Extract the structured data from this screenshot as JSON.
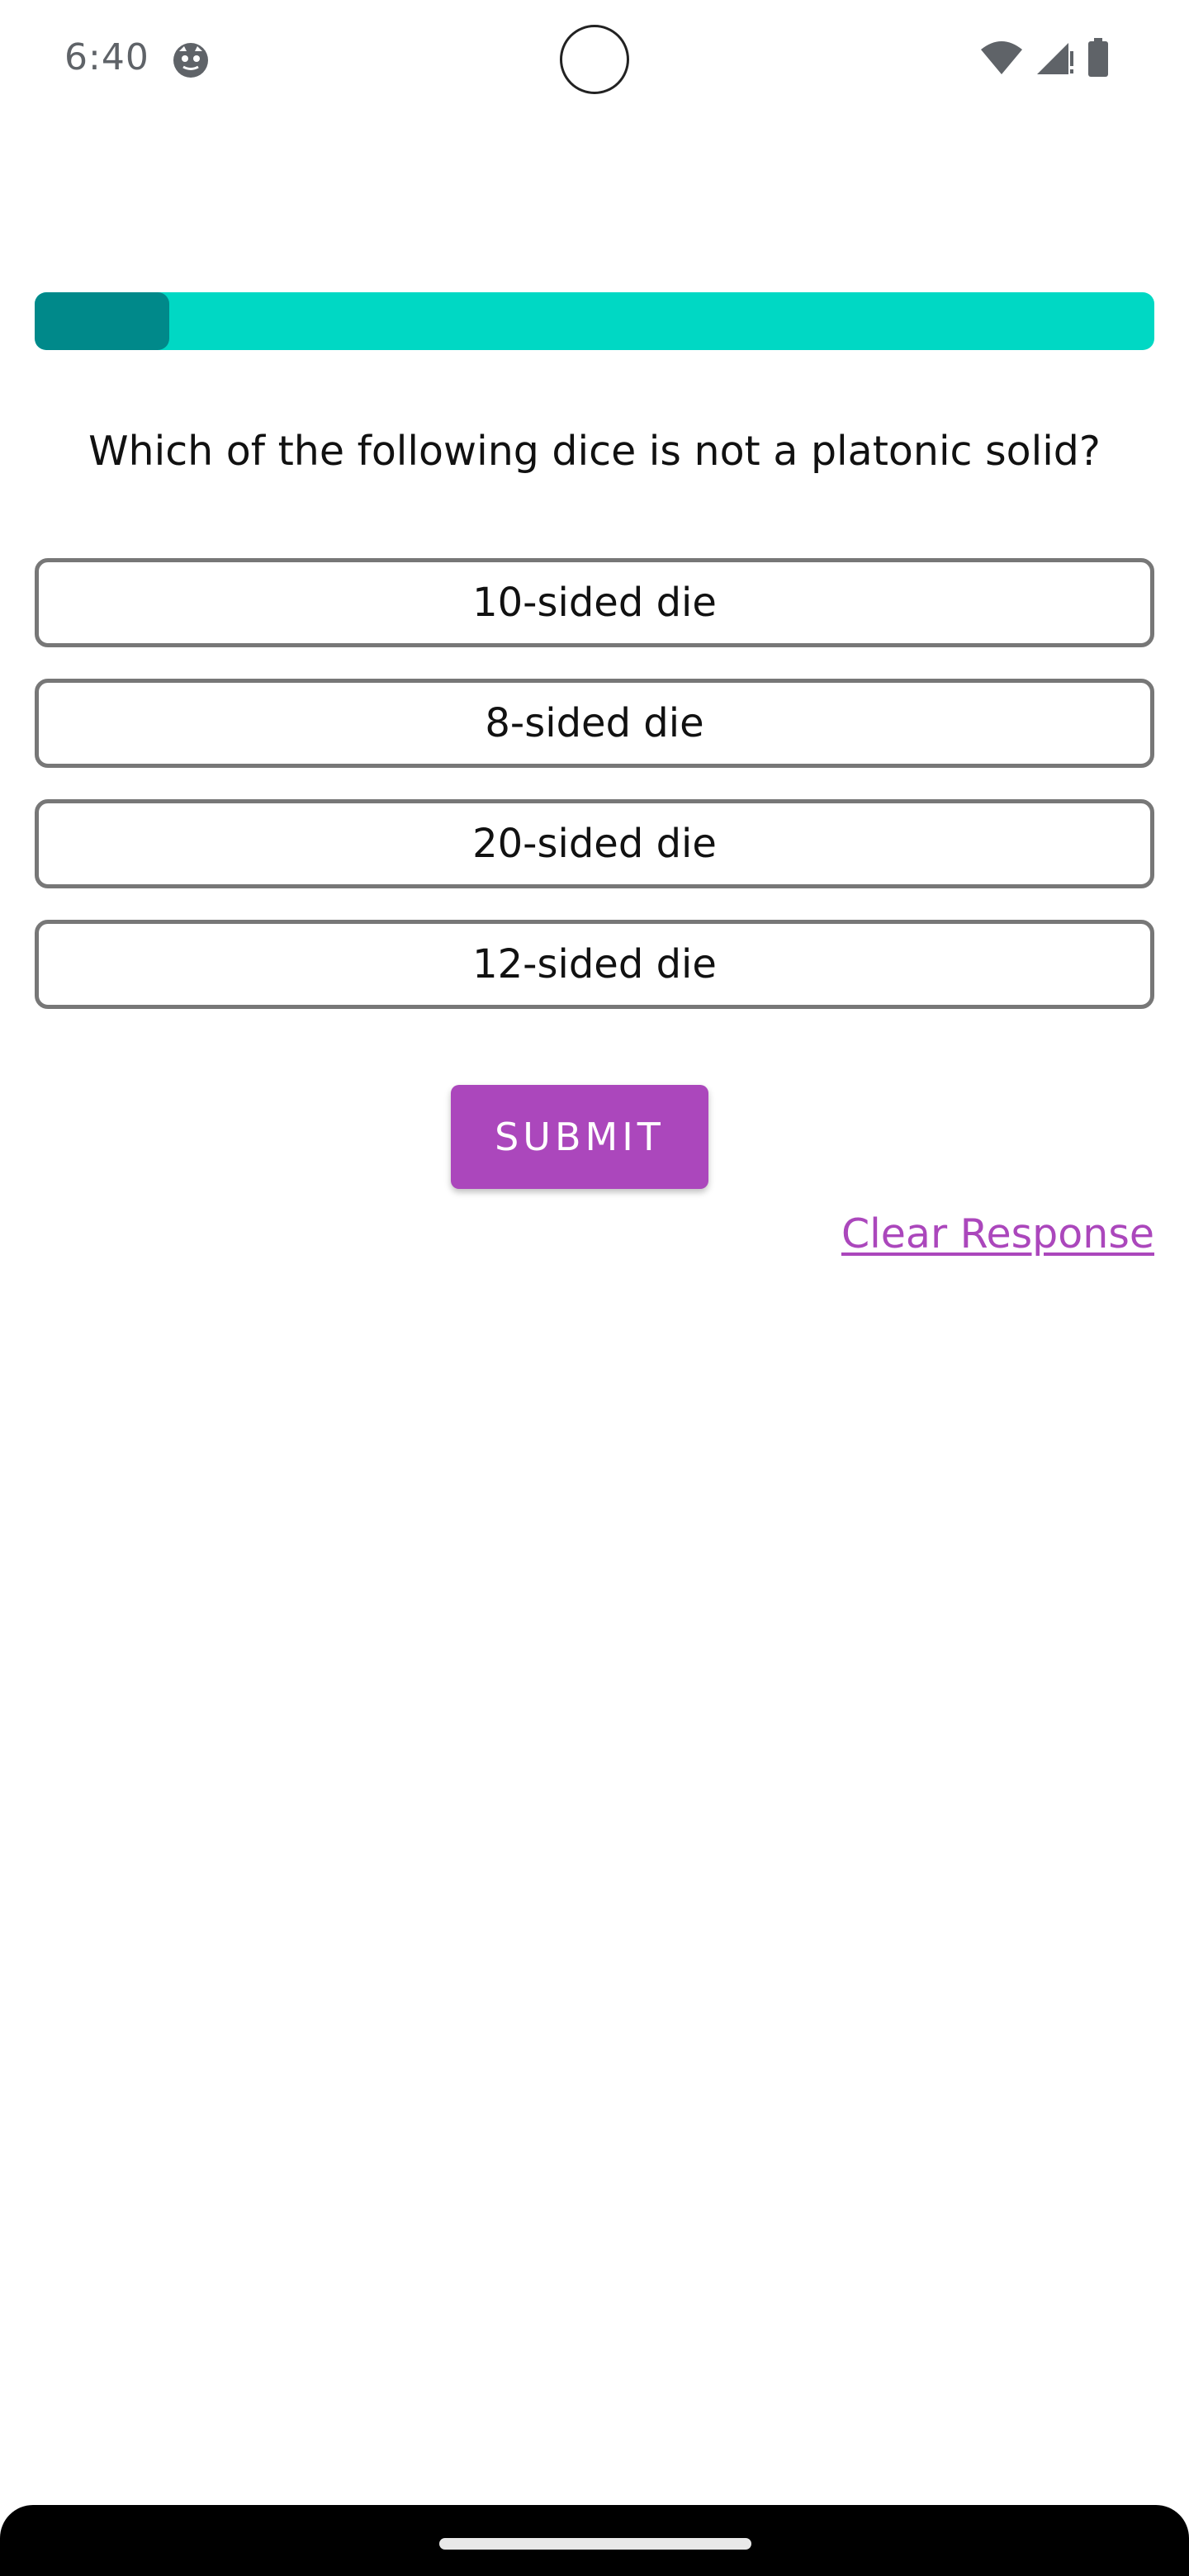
{
  "status_bar": {
    "time": "6:40",
    "icons": [
      "notification-face-icon",
      "wifi-icon",
      "signal-icon",
      "battery-icon"
    ]
  },
  "progress": {
    "value": 0.12,
    "track_color": "#00d8c4",
    "fill_color": "#00898a"
  },
  "quiz": {
    "question": "Which of the following dice is not a platonic solid?",
    "options": [
      {
        "label": "10-sided die"
      },
      {
        "label": "8-sided die"
      },
      {
        "label": "20-sided die"
      },
      {
        "label": "12-sided die"
      }
    ],
    "submit_label": "SUBMIT",
    "clear_label": "Clear Response"
  },
  "theme": {
    "accent": "#ab47bc",
    "option_border": "#777777"
  }
}
